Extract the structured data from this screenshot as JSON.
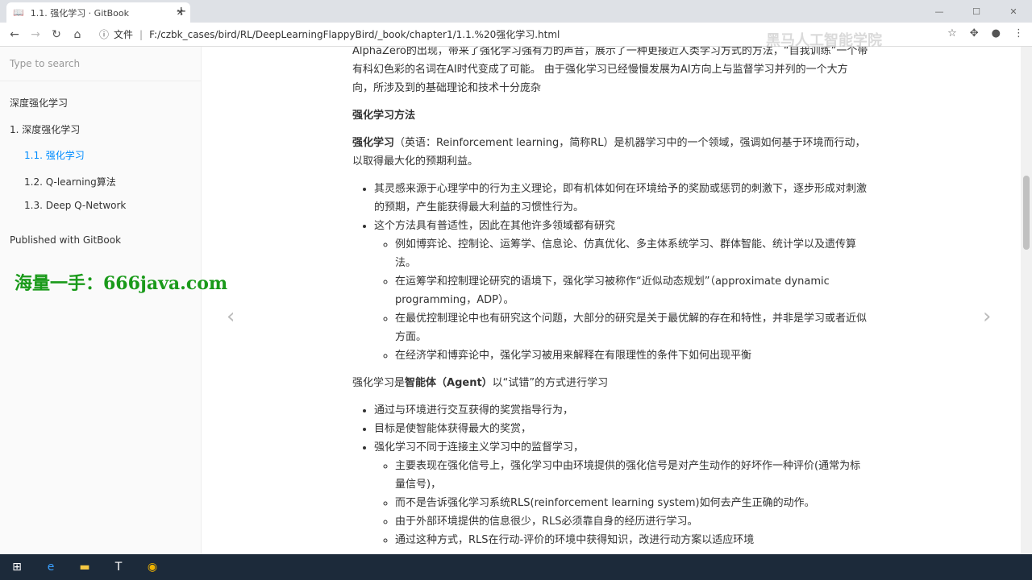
{
  "browser": {
    "tab_title": "1.1. 强化学习 · GitBook",
    "tab_icon": "book-icon",
    "address_prefix": "文件",
    "url": "F:/czbk_cases/bird/RL/DeepLearningFlappyBird/_book/chapter1/1.1.%20强化学习.html",
    "watermark": "黑马人工智能学院"
  },
  "sidebar": {
    "search_placeholder": "Type to search",
    "items": [
      {
        "label": "深度强化学习"
      },
      {
        "label": "1. 深度强化学习"
      },
      {
        "label": "1.1. 强化学习"
      },
      {
        "label": "1.2. Q-learning算法"
      },
      {
        "label": "1.3. Deep Q-Network"
      }
    ],
    "published": "Published with GitBook",
    "overlay_text": "海量一手：666java.com"
  },
  "content": {
    "intro": "AlphaZero的出现，带来了强化学习强有力的声音，展示了一种更接近人类学习方式的方法，“自我训练”一个带有科幻色彩的名词在AI时代变成了可能。 由于强化学习已经慢慢发展为AI方向上与监督学习并列的一个大方向，所涉及到的基础理论和技术十分庞杂",
    "heading": "强化学习方法",
    "def_bold": "强化学习",
    "def_text": "（英语：Reinforcement learning，简称RL）是机器学习中的一个领域，强调如何基于环境而行动，以取得最大化的预期利益。",
    "list1": [
      "其灵感来源于心理学中的行为主义理论，即有机体如何在环境给予的奖励或惩罚的刺激下，逐步形成对刺激的预期，产生能获得最大利益的习惯性行为。",
      "这个方法具有普适性，因此在其他许多领域都有研究"
    ],
    "list1_sub": [
      "例如博弈论、控制论、运筹学、信息论、仿真优化、多主体系统学习、群体智能、统计学以及遗传算法。",
      "在运筹学和控制理论研究的语境下，强化学习被称作“近似动态规划”（approximate dynamic programming，ADP）。",
      "在最优控制理论中也有研究这个问题，大部分的研究是关于最优解的存在和特性，并非是学习或者近似方面。",
      "在经济学和博弈论中，强化学习被用来解释在有限理性的条件下如何出现平衡"
    ],
    "agent_pre": "强化学习是",
    "agent_bold": "智能体（Agent）",
    "agent_post": "以“试错”的方式进行学习",
    "list2": [
      "通过与环境进行交互获得的奖赏指导行为，",
      "目标是使智能体获得最大的奖赏，",
      "强化学习不同于连接主义学习中的监督学习，"
    ],
    "list2_sub": [
      "主要表现在强化信号上，强化学习中由环境提供的强化信号是对产生动作的好坏作一种评价(通常为标量信号)，",
      "而不是告诉强化学习系统RLS(reinforcement learning system)如何去产生正确的动作。",
      "由于外部环境提供的信息很少，RLS必须靠自身的经历进行学习。",
      "通过这种方式，RLS在行动-评价的环境中获得知识，改进行动方案以适应环境"
    ]
  },
  "colors": {
    "active_link": "#008cff",
    "overlay": "#1a9a1a",
    "taskbar": "#1c2a3a"
  }
}
